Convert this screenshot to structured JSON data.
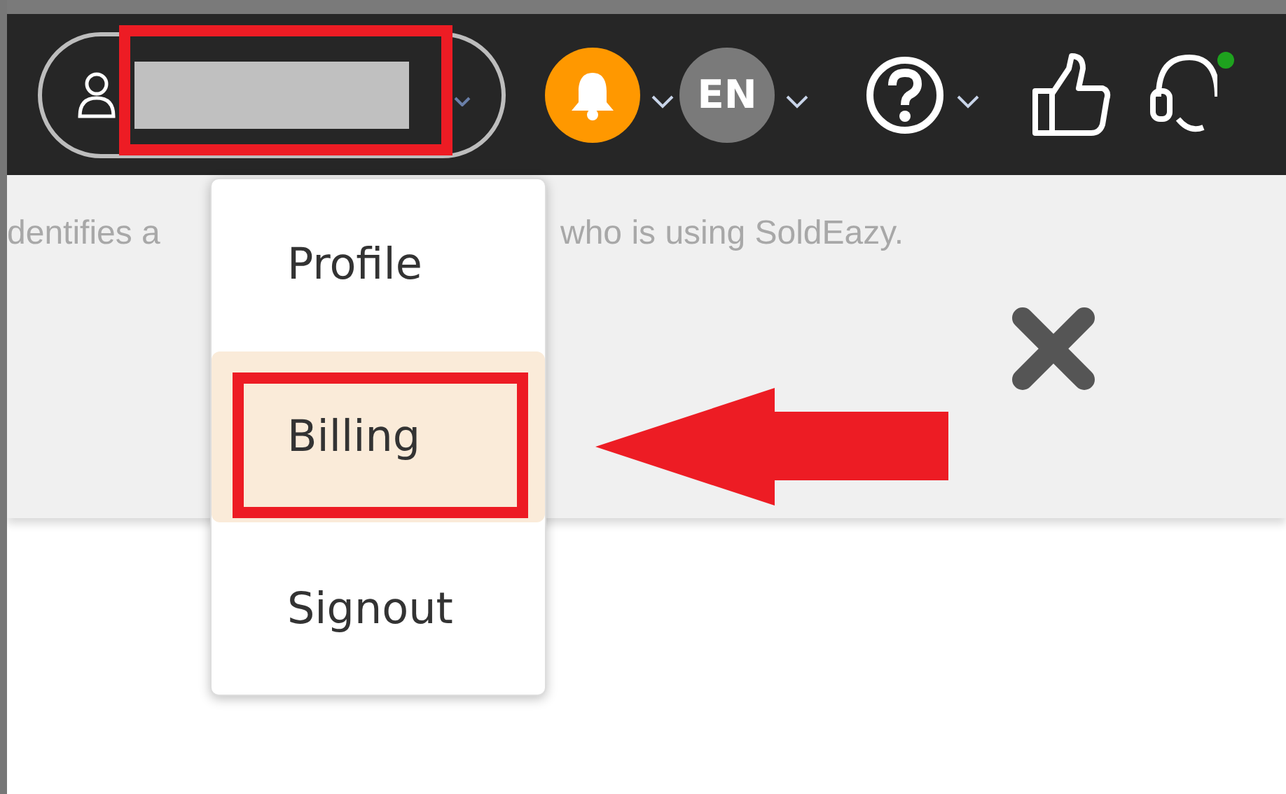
{
  "header": {
    "language": "EN",
    "notification_dot": true
  },
  "banner": {
    "text_parts": [
      "dentifies a",
      "who is using SoldEazy."
    ]
  },
  "user_menu": {
    "items": [
      {
        "label": "Profile",
        "selected": false
      },
      {
        "label": "Billing",
        "selected": true
      },
      {
        "label": "Signout",
        "selected": false
      }
    ]
  },
  "annotations": [
    {
      "kind": "box"
    },
    {
      "kind": "box"
    },
    {
      "kind": "arrow"
    }
  ]
}
